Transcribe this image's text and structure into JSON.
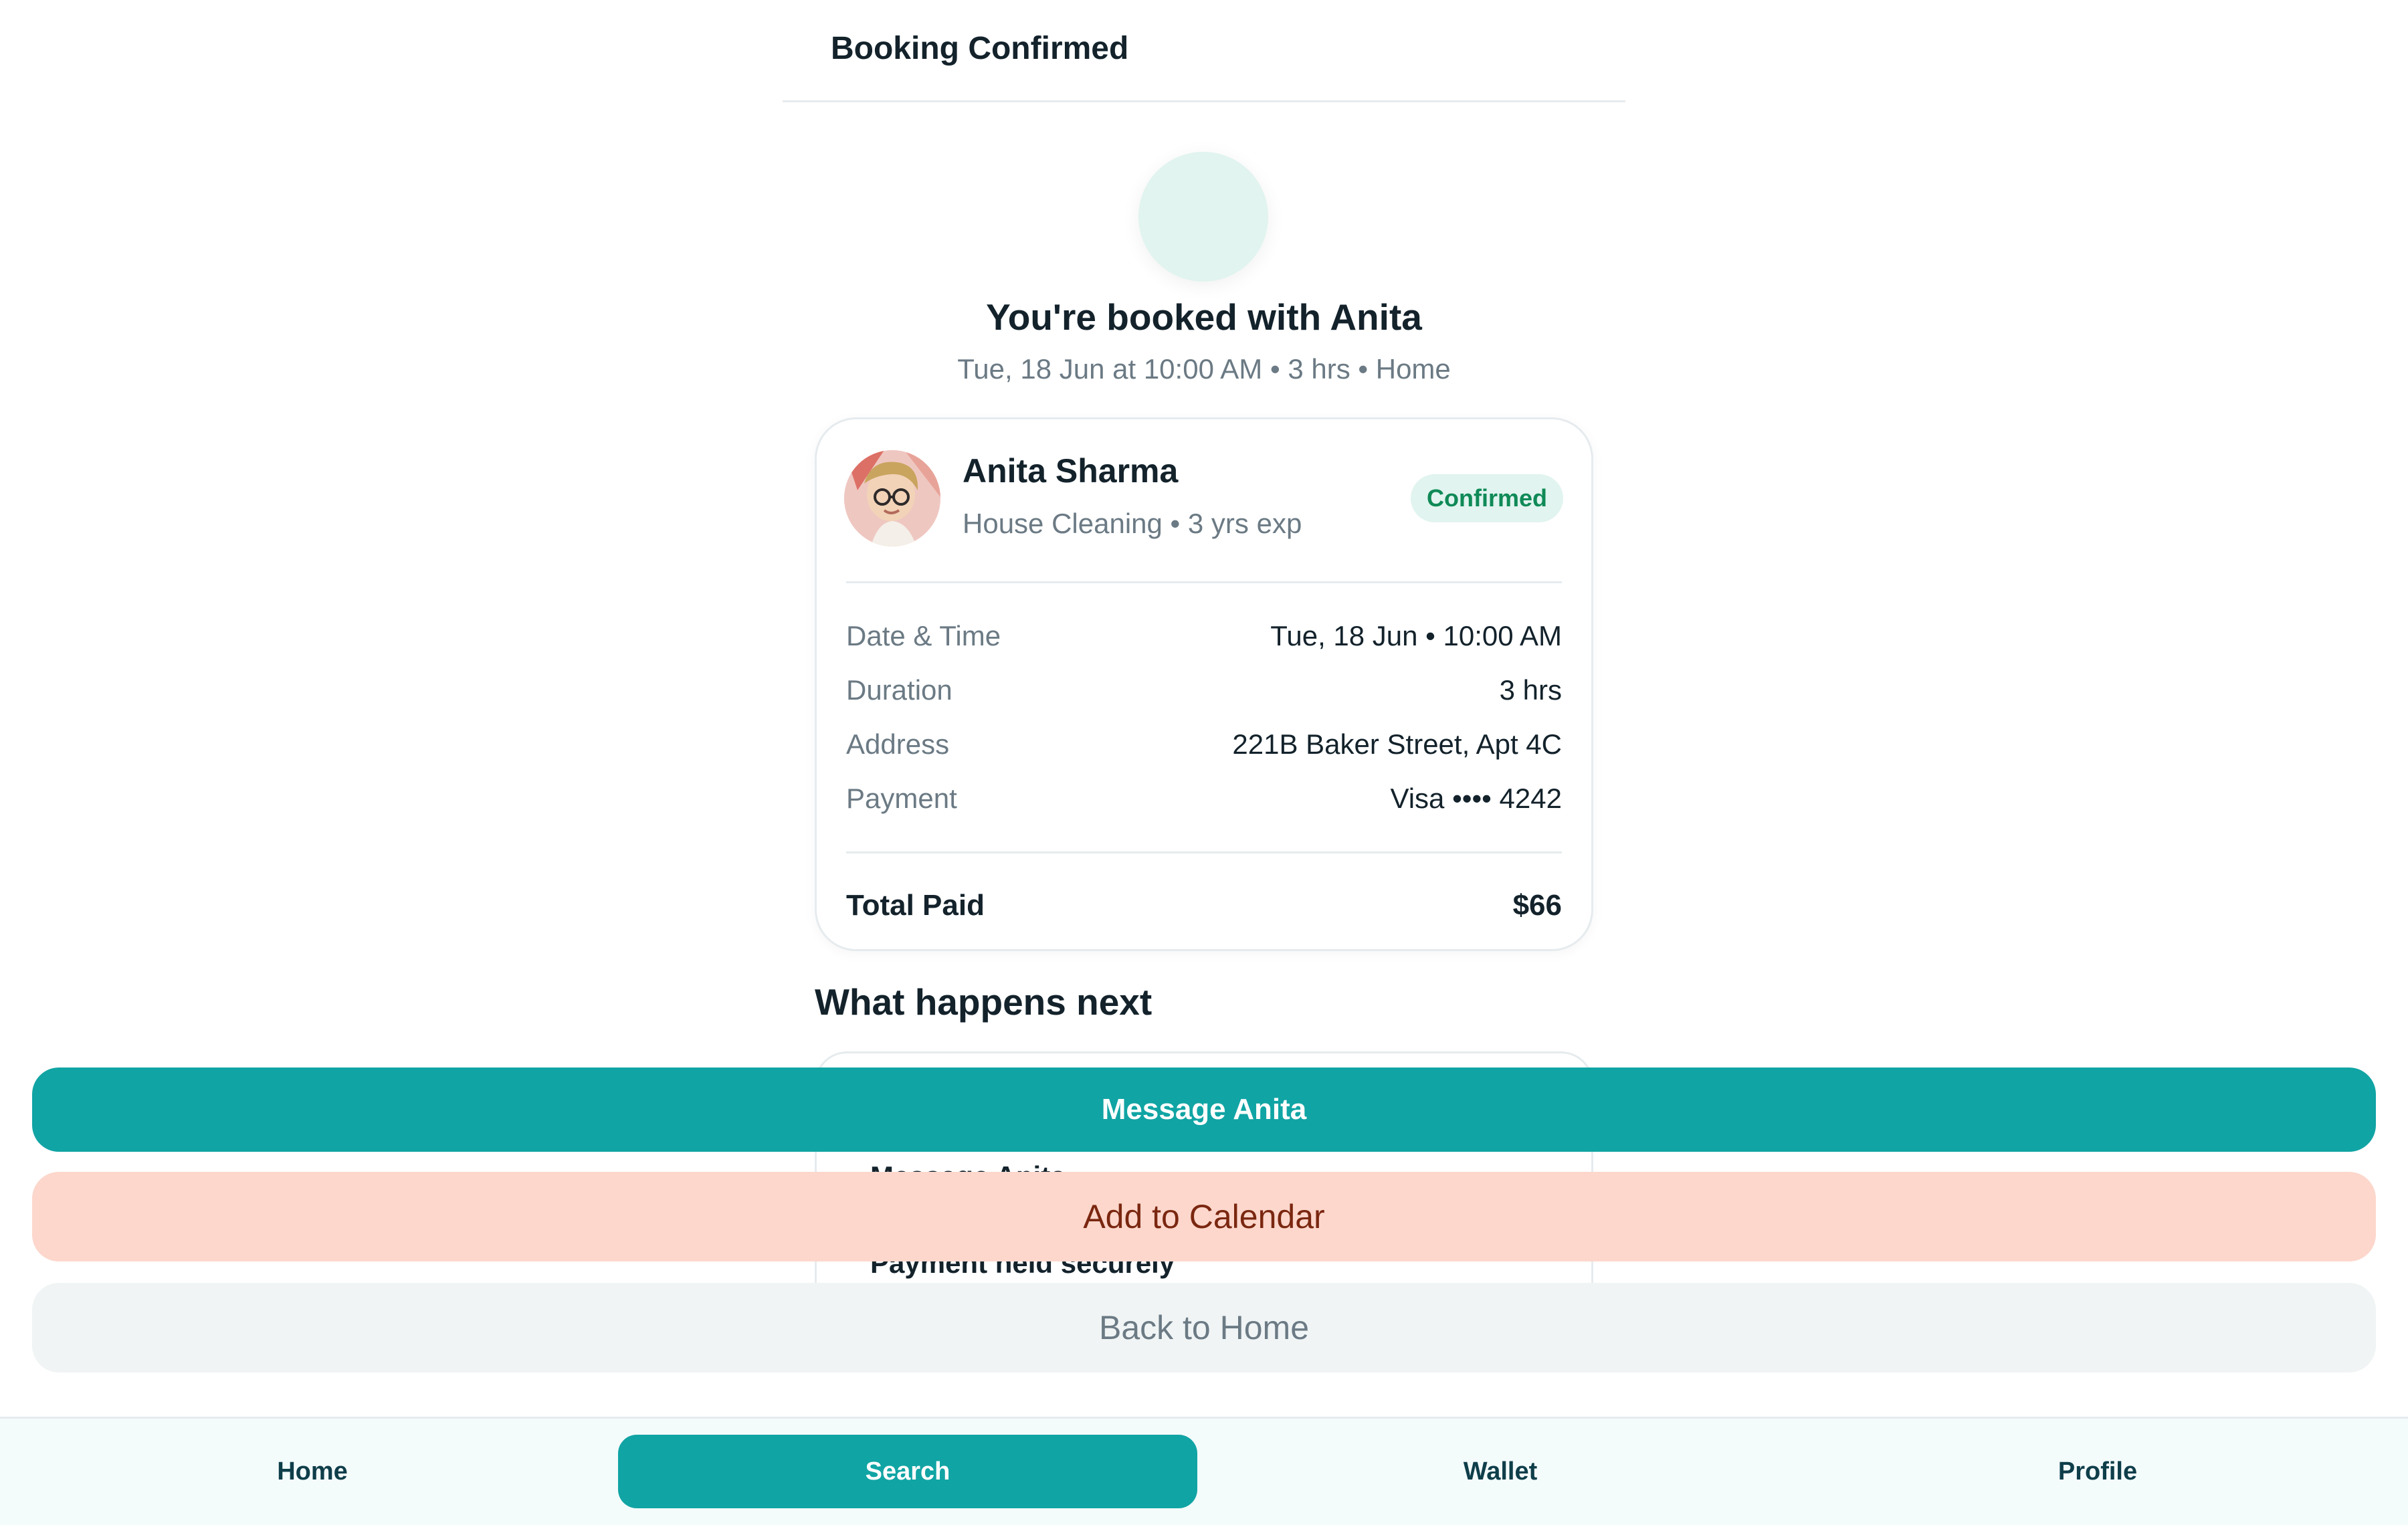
{
  "header": {
    "title": "Booking Confirmed"
  },
  "hero": {
    "title": "You're booked with Anita",
    "subtitle": "Tue, 18 Jun at 10:00 AM • 3 hrs • Home"
  },
  "provider": {
    "name": "Anita Sharma",
    "meta": "House Cleaning • 3 yrs exp",
    "status": "Confirmed"
  },
  "details": [
    {
      "label": "Date & Time",
      "value": "Tue, 18 Jun • 10:00 AM"
    },
    {
      "label": "Duration",
      "value": "3 hrs"
    },
    {
      "label": "Address",
      "value": "221B Baker Street, Apt 4C"
    },
    {
      "label": "Payment",
      "value": "Visa •••• 4242"
    }
  ],
  "total": {
    "label": "Total Paid",
    "value": "$66"
  },
  "next": {
    "title": "What happens next",
    "items": [
      "Message Anita",
      "Payment held securely"
    ]
  },
  "actions": {
    "message": "Message Anita",
    "calendar": "Add to Calendar",
    "home": "Back to Home"
  },
  "tabs": [
    {
      "label": "Home"
    },
    {
      "label": "Search"
    },
    {
      "label": "Wallet"
    },
    {
      "label": "Profile"
    }
  ],
  "colors": {
    "accent": "#11a4a4",
    "success": "#0f8a57",
    "secondary_bg": "#fdd7cc"
  }
}
